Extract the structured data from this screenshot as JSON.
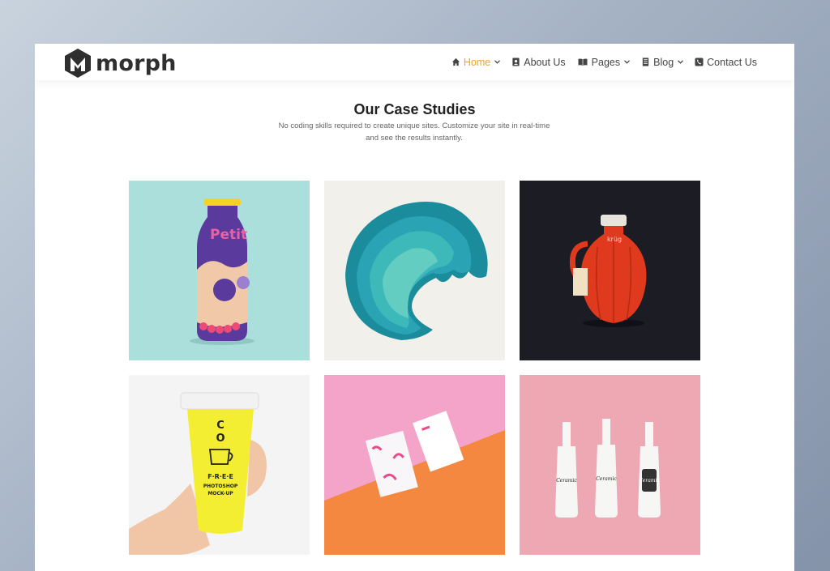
{
  "brand": {
    "name": "morph"
  },
  "nav": {
    "items": [
      {
        "label": "Home",
        "icon": "home-icon",
        "dropdown": true,
        "active": true
      },
      {
        "label": "About Us",
        "icon": "person-card-icon",
        "dropdown": false
      },
      {
        "label": "Pages",
        "icon": "book-icon",
        "dropdown": true
      },
      {
        "label": "Blog",
        "icon": "document-icon",
        "dropdown": true
      },
      {
        "label": "Contact Us",
        "icon": "phone-icon",
        "dropdown": false
      }
    ],
    "active_color": "#f0a22e"
  },
  "section": {
    "title": "Our Case Studies",
    "subtitle_line1": "No coding skills required to create unique sites. Customize your site in real-time",
    "subtitle_line2": "and see the results instantly."
  },
  "gallery": {
    "bottle_label": "Petit",
    "jug_label": "krüg",
    "cup_lines": [
      "C",
      "O",
      "F·R·E·E",
      "PHOTOSHOP",
      "MOCK-UP"
    ],
    "bottle_labels": [
      "Ceramic",
      "Ceramic",
      "Ceramic"
    ]
  }
}
